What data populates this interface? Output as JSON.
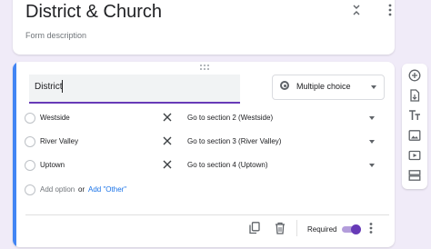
{
  "form": {
    "title": "District & Church",
    "description_placeholder": "Form description"
  },
  "question": {
    "title": "District",
    "type_label": "Multiple choice",
    "options": [
      {
        "label": "Westside",
        "goto": "Go to section 2 (Westside)"
      },
      {
        "label": "River Valley",
        "goto": "Go to section 3 (River Valley)"
      },
      {
        "label": "Uptown",
        "goto": "Go to section 4 (Uptown)"
      }
    ],
    "add_option_label": "Add option",
    "or_label": "or",
    "add_other_label": "Add \"Other\"",
    "required_label": "Required",
    "required": true
  },
  "toolbar": {
    "icons": [
      "add-question-icon",
      "import-questions-icon",
      "add-title-icon",
      "add-image-icon",
      "add-video-icon",
      "add-section-icon"
    ]
  },
  "colors": {
    "background": "#f0ebf8",
    "accent": "#673ab7",
    "active_border": "#4285f4",
    "link": "#1a73e8"
  }
}
